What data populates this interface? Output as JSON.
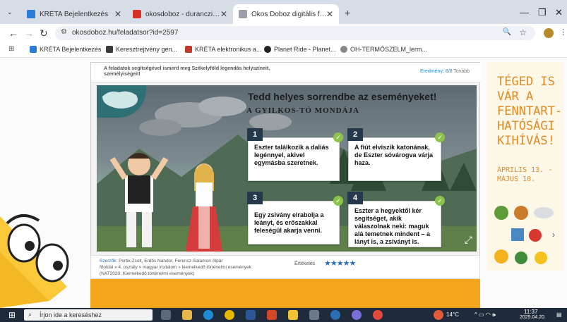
{
  "browser": {
    "tabs": [
      {
        "title": "KRÉTA Bejelentkezés",
        "active": false,
        "color": "#2b7bd8"
      },
      {
        "title": "okosdoboz - duranczik.eva@gm",
        "active": false,
        "color": "#d93025"
      },
      {
        "title": "Okos Doboz digitális feladatgy",
        "active": true,
        "color": "#9aa0a6"
      }
    ],
    "new_tab": "+",
    "url": "okosdoboz.hu/feladatsor?id=2597",
    "bookmarks": [
      {
        "label": "KRÉTA Bejelentkezés",
        "color": "#2b7bd8"
      },
      {
        "label": "Keresztrejtvény gen...",
        "color": "#3a3a3a"
      },
      {
        "label": "KRÉTA elektronikus a...",
        "color": "#c0392b"
      },
      {
        "label": "Planet Ride - Planet...",
        "color": "#222222"
      },
      {
        "label": "OH-TERMŐSZELM_lerm...",
        "color": "#888888"
      }
    ]
  },
  "lesson": {
    "description": "A feladatok segítségével ismerd meg Székelyföld legendás helyszíneit, személyiségeit!",
    "score_label": "Eredmény:",
    "score_value": "8/8",
    "next_label": "Tovább",
    "game_title": "Tedd helyes sorrendbe az eseményeket!",
    "game_subtitle": "A GYILKOS-TÓ MONDÁJA",
    "cards": [
      {
        "num": "1",
        "text": "Eszter találkozik a daliás legénnyel, akivel egymásba szeretnek."
      },
      {
        "num": "2",
        "text": "A fiút elviszik katonának, de Eszter sóvárogva várja haza."
      },
      {
        "num": "3",
        "text": "Egy zsivány elrabolja a leányt, és erőszakkal feleségül akarja venni."
      },
      {
        "num": "4",
        "text": "Eszter a hegyektől kér segítséget, akik válaszolnak neki: maguk alá temetnek mindent – a lányt is, a zsiványt is."
      }
    ],
    "authors_label": "Szerzők:",
    "authors": "Portik Zsolt, Erdős Nándor, Ferencz-Salamon Alpár",
    "breadcrumb": "főoldal » 4. osztály » magyar irodalom » kiemelkedő történelmi események",
    "nat": "(NAT2020: Kiemelkedő történelmi események)",
    "rating_label": "Értékelés",
    "stars": "★★★★★"
  },
  "ad": {
    "text": "TÉGED IS VÁR A FENNTART-HATÓSÁGI KIHÍVÁS!",
    "date": "ÁPRILIS 13. - MÁJUS 10."
  },
  "taskbar": {
    "search_placeholder": "Írjon ide a kereséshez",
    "temperature": "14°C",
    "time": "11:37",
    "date": "2025.04.20."
  }
}
